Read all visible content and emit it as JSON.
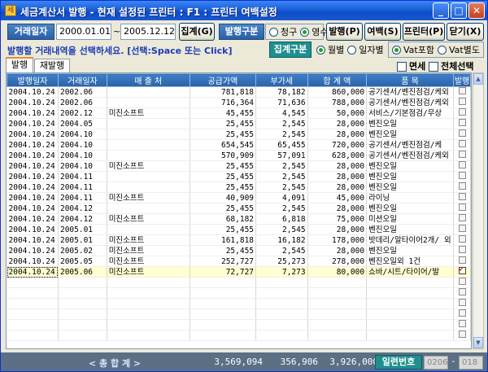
{
  "window": {
    "title": "세금계산서 발행 - 현재 설정된 프린터 :    F1 : 프린터 여백설정",
    "app_icon_glyph": "세",
    "minimize_glyph": "_",
    "maximize_glyph": "□",
    "close_glyph": "✕"
  },
  "filters": {
    "date_label": "거래일자",
    "date_from": "2000.01.01",
    "date_sep": "~",
    "date_to": "2005.12.12",
    "aggregate_button": "집계(G)",
    "issue_type_label": "발행구분",
    "issue_types": [
      {
        "label": "청구",
        "selected": false
      },
      {
        "label": "영수",
        "selected": true
      }
    ],
    "issue_button": "발행(P)",
    "margin_button": "여백(S)",
    "printer_button": "프린터(P)",
    "close_button": "닫기(X)"
  },
  "info": {
    "instruction": "발행할 거래내역을 선택하세요. [선택:Space 또는 Click]",
    "aggregate_type_label": "집계구분",
    "aggregate_types": [
      {
        "label": "월별",
        "selected": true
      },
      {
        "label": "일자별",
        "selected": false
      }
    ],
    "vat_types": [
      {
        "label": "Vat포함",
        "selected": true
      },
      {
        "label": "Vat별도",
        "selected": false
      }
    ],
    "tax_free_label": "면세",
    "select_all_label": "전체선택"
  },
  "tabs": [
    {
      "label": "발행",
      "active": true
    },
    {
      "label": "재발행",
      "active": false
    }
  ],
  "table": {
    "columns": [
      "발행일자",
      "거래일자",
      "매 출 처",
      "공급가액",
      "부가세",
      "합 계 액",
      "품  목",
      "발행"
    ],
    "rows": [
      {
        "issue_date": "2004.10.24",
        "trade_date": "2002.06",
        "customer": "",
        "supply": "781,818",
        "vat": "78,182",
        "total": "860,000",
        "item": "공기센서/벤진점검/케외",
        "issued": false
      },
      {
        "issue_date": "2004.10.24",
        "trade_date": "2002.06",
        "customer": "",
        "supply": "716,364",
        "vat": "71,636",
        "total": "788,000",
        "item": "공기센서/벤진점검/케외",
        "issued": false
      },
      {
        "issue_date": "2004.10.24",
        "trade_date": "2002.12",
        "customer": "미진소프트",
        "supply": "45,455",
        "vat": "4,545",
        "total": "50,000",
        "item": "서비스/기본점검/무상",
        "issued": false
      },
      {
        "issue_date": "2004.10.24",
        "trade_date": "2004.05",
        "customer": "",
        "supply": "25,455",
        "vat": "2,545",
        "total": "28,000",
        "item": "벤진오일",
        "issued": false
      },
      {
        "issue_date": "2004.10.24",
        "trade_date": "2004.10",
        "customer": "",
        "supply": "25,455",
        "vat": "2,545",
        "total": "28,000",
        "item": "벤진오일",
        "issued": false
      },
      {
        "issue_date": "2004.10.24",
        "trade_date": "2004.10",
        "customer": "",
        "supply": "654,545",
        "vat": "65,455",
        "total": "720,000",
        "item": "공기센서/벤진점검/케",
        "issued": false
      },
      {
        "issue_date": "2004.10.24",
        "trade_date": "2004.10",
        "customer": "",
        "supply": "570,909",
        "vat": "57,091",
        "total": "628,000",
        "item": "공기센서/벤진점검/케외",
        "issued": false
      },
      {
        "issue_date": "2004.10.24",
        "trade_date": "2004.10",
        "customer": "미진소프트",
        "supply": "25,455",
        "vat": "2,545",
        "total": "28,000",
        "item": "벤진오일",
        "issued": false
      },
      {
        "issue_date": "2004.10.24",
        "trade_date": "2004.11",
        "customer": "",
        "supply": "25,455",
        "vat": "2,545",
        "total": "28,000",
        "item": "벤진오일",
        "issued": false
      },
      {
        "issue_date": "2004.10.24",
        "trade_date": "2004.11",
        "customer": "",
        "supply": "25,455",
        "vat": "2,545",
        "total": "28,000",
        "item": "벤진오일",
        "issued": false
      },
      {
        "issue_date": "2004.10.24",
        "trade_date": "2004.11",
        "customer": "미진소프트",
        "supply": "40,909",
        "vat": "4,091",
        "total": "45,000",
        "item": "라이닝",
        "issued": false
      },
      {
        "issue_date": "2004.10.24",
        "trade_date": "2004.12",
        "customer": "",
        "supply": "25,455",
        "vat": "2,545",
        "total": "28,000",
        "item": "벤진오일",
        "issued": false
      },
      {
        "issue_date": "2004.10.24",
        "trade_date": "2004.12",
        "customer": "미진소프트",
        "supply": "68,182",
        "vat": "6,818",
        "total": "75,000",
        "item": "미션오일",
        "issued": false
      },
      {
        "issue_date": "2004.10.24",
        "trade_date": "2005.01",
        "customer": "",
        "supply": "25,455",
        "vat": "2,545",
        "total": "28,000",
        "item": "벤진오일",
        "issued": false
      },
      {
        "issue_date": "2004.10.24",
        "trade_date": "2005.01",
        "customer": "미진소프트",
        "supply": "161,818",
        "vat": "16,182",
        "total": "178,000",
        "item": "밧데리/알타이어2개/ 외",
        "issued": false
      },
      {
        "issue_date": "2004.10.24",
        "trade_date": "2005.02",
        "customer": "미진소프트",
        "supply": "25,455",
        "vat": "2,545",
        "total": "28,000",
        "item": "벤진오일",
        "issued": false
      },
      {
        "issue_date": "2004.10.24",
        "trade_date": "2005.05",
        "customer": "미진소프트",
        "supply": "252,727",
        "vat": "25,273",
        "total": "278,000",
        "item": "벤진오일외 1건",
        "issued": false
      },
      {
        "issue_date": "2004.10.24",
        "trade_date": "2005.06",
        "customer": "미진소프트",
        "supply": "72,727",
        "vat": "7,273",
        "total": "80,000",
        "item": "쇼바/시트/타이어/발",
        "issued": true
      }
    ]
  },
  "totals": {
    "label": "< 총    합    계 >",
    "supply": "3,569,094",
    "vat": "356,906",
    "total": "3,926,000",
    "serial_label": "일련번호",
    "serial_from": "0206",
    "serial_sep": "-",
    "serial_to": "018"
  }
}
